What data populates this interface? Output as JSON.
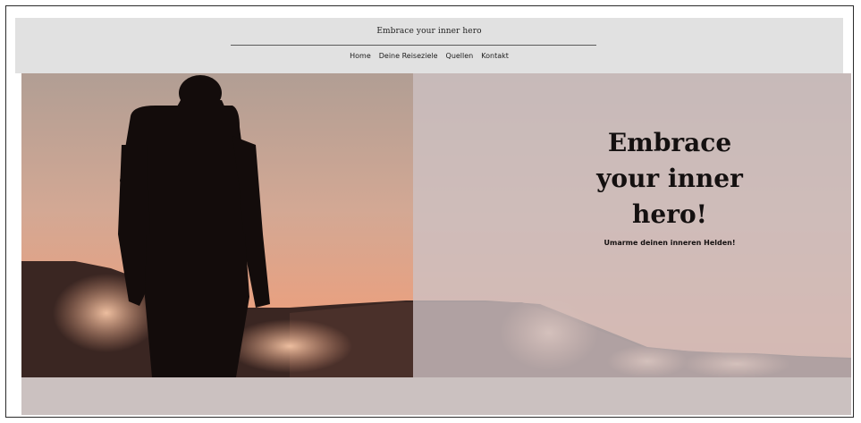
{
  "header": {
    "site_title": "Embrace your inner hero",
    "nav": [
      {
        "label": "Home"
      },
      {
        "label": "Deine Reiseziele"
      },
      {
        "label": "Quellen"
      },
      {
        "label": "Kontakt"
      }
    ]
  },
  "hero": {
    "heading_line1": "Embrace",
    "heading_line2": "your inner",
    "heading_line3": "hero!",
    "subheading": "Umarme deinen inneren Helden!"
  },
  "colors": {
    "header_bg": "#e1e1e1",
    "sky_warm": "#e6a282",
    "overlay": "#cdc2c4",
    "footer_band": "#cbc1c0"
  }
}
